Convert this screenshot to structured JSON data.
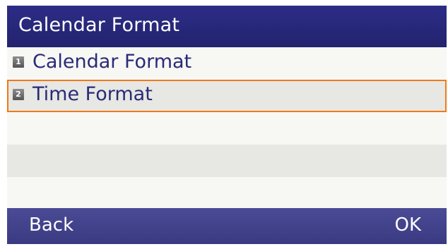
{
  "title": "Calendar Format",
  "menu": {
    "items": [
      {
        "number": "1",
        "label": "Calendar Format",
        "selected": false
      },
      {
        "number": "2",
        "label": "Time Format",
        "selected": true
      }
    ]
  },
  "softkeys": {
    "back": "Back",
    "ok": "OK"
  },
  "colors": {
    "title_bar": "#2c2c86",
    "softkey_bar": "#44448e",
    "selection_border": "#ef7a1a",
    "label_text": "#2a2a78"
  }
}
